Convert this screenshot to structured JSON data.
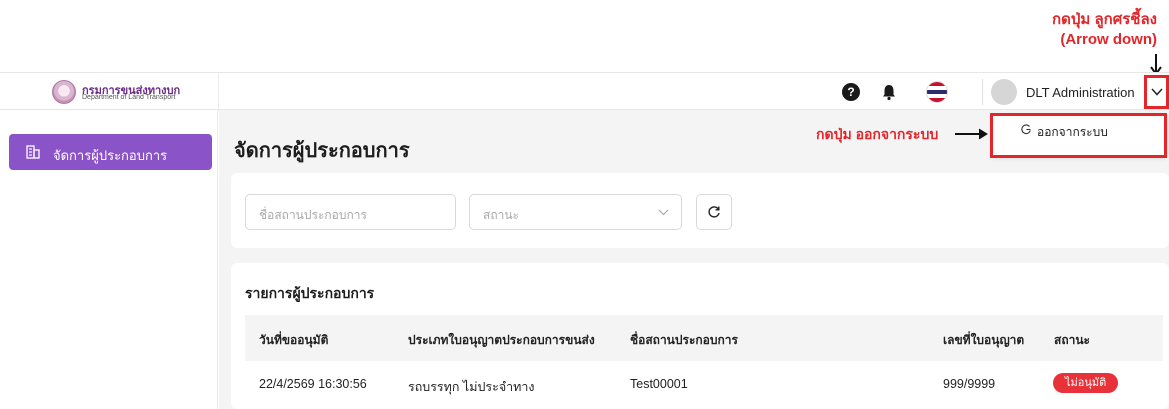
{
  "annotations": {
    "top_right": [
      "กดปุ่ม ลูกศรชี้ลง",
      "(Arrow down)"
    ],
    "logout_hint": "กดปุ่ม ออกจากระบบ"
  },
  "header": {
    "brand_th": "กรมการขนส่งทางบก",
    "brand_en": "Department of Land Transport",
    "help_icon": "question-icon",
    "help_glyph": "?",
    "bell_icon": "bell-icon",
    "flag_icon": "thai-flag-icon",
    "user_name": "DLT Administration",
    "chevron_icon": "chevron-down-icon"
  },
  "user_menu": {
    "logout_label": "ออกจากระบบ",
    "logout_icon": "power-icon"
  },
  "sidebar": {
    "items": [
      {
        "label": "จัดการผู้ประกอบการ",
        "icon": "building-icon",
        "active": true
      }
    ]
  },
  "main": {
    "page_title": "จัดการผู้ประกอบการ",
    "filters": {
      "name_placeholder": "ชื่อสถานประกอบการ",
      "status_placeholder": "สถานะ",
      "refresh_icon": "refresh-icon"
    },
    "list": {
      "title": "รายการผู้ประกอบการ",
      "columns": [
        "วันที่ขออนุมัติ",
        "ประเภทใบอนุญาตประกอบการขนส่ง",
        "ชื่อสถานประกอบการ",
        "เลขที่ใบอนุญาต",
        "สถานะ"
      ],
      "rows": [
        {
          "date": "22/4/2569 16:30:56",
          "license_type": "รถบรรทุก ไม่ประจำทาง",
          "name": "Test00001",
          "license_no": "999/9999",
          "status": "ไม่อนุมัติ"
        }
      ]
    }
  },
  "colors": {
    "accent": "#8b53c8",
    "annotation": "#e3262a",
    "reject_badge": "#e8323a",
    "brand": "#6a2a86"
  }
}
